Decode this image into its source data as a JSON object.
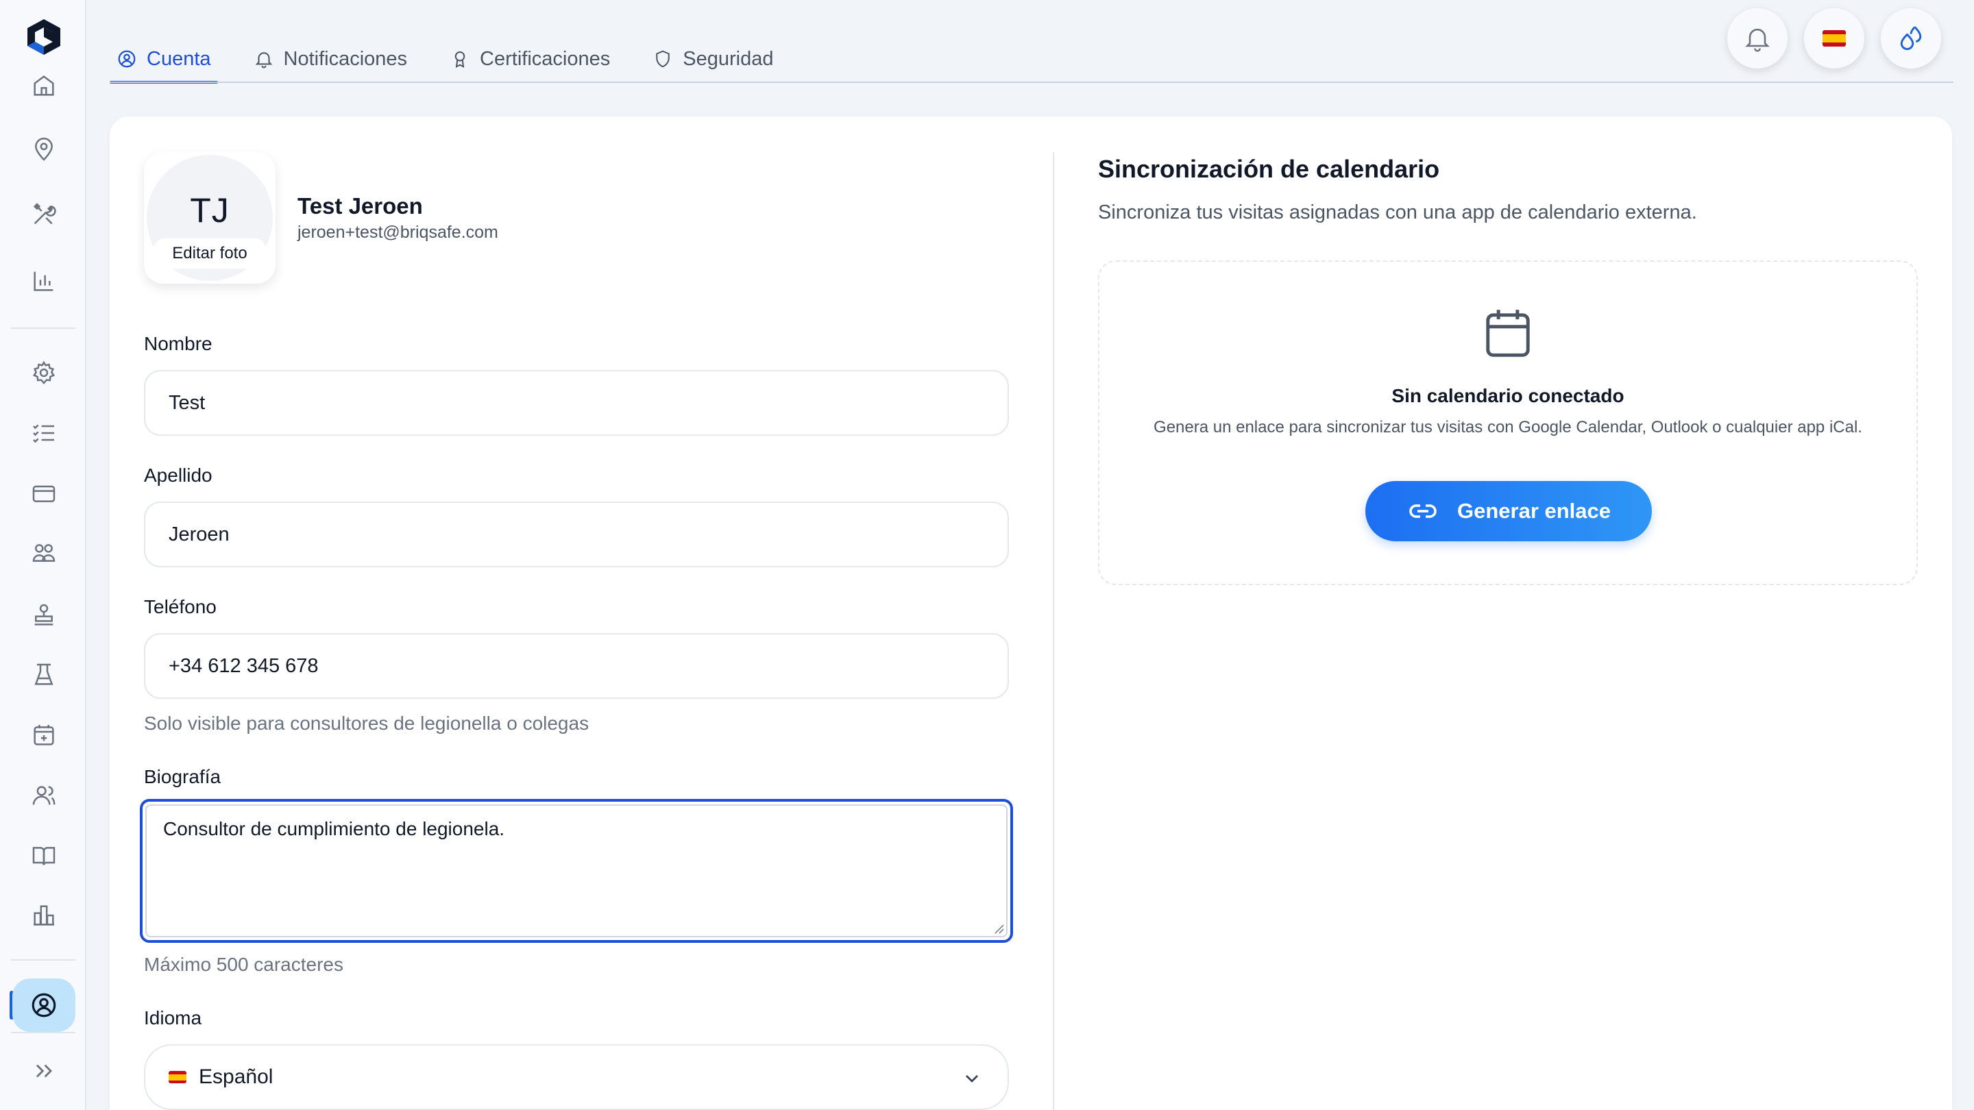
{
  "tabs": [
    {
      "label": "Cuenta",
      "icon": "user-circle-icon",
      "active": true
    },
    {
      "label": "Notificaciones",
      "icon": "bell-icon"
    },
    {
      "label": "Certificaciones",
      "icon": "award-icon"
    },
    {
      "label": "Seguridad",
      "icon": "shield-icon"
    }
  ],
  "profile": {
    "initials": "TJ",
    "edit_photo": "Editar foto",
    "name": "Test Jeroen",
    "email": "jeroen+test@briqsafe.com"
  },
  "form": {
    "nombre_label": "Nombre",
    "nombre_value": "Test",
    "apellido_label": "Apellido",
    "apellido_value": "Jeroen",
    "telefono_label": "Teléfono",
    "telefono_value": "+34 612 345 678",
    "telefono_hint": "Solo visible para consultores de legionella o colegas",
    "bio_label": "Biografía",
    "bio_value": "Consultor de cumplimiento de legionela.",
    "bio_hint": "Máximo 500 caracteres",
    "idioma_label": "Idioma",
    "idioma_value": "Español"
  },
  "calendar": {
    "title": "Sincronización de calendario",
    "subtitle": "Sincroniza tus visitas asignadas con una app de calendario externa.",
    "empty_title": "Sin calendario conectado",
    "empty_desc": "Genera un enlace para sincronizar tus visitas con Google Calendar, Outlook o cualquier app iCal.",
    "button": "Generar enlace"
  },
  "colors": {
    "accent": "#1d63d6",
    "active_nav_bg": "#bfe3fb",
    "button_start": "#1d6ff2",
    "button_end": "#2f96f5"
  }
}
